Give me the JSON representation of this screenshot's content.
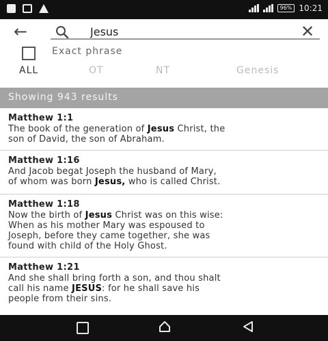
{
  "status_bar": {
    "time": "10:21",
    "battery_text": "96%"
  },
  "search": {
    "query": "Jesus"
  },
  "exact_phrase": {
    "label": "Exact phrase",
    "checked": false
  },
  "tabs": [
    {
      "label": "ALL",
      "active": true
    },
    {
      "label": "OT",
      "active": false
    },
    {
      "label": "NT",
      "active": false
    },
    {
      "label": "Genesis",
      "active": false
    }
  ],
  "results_header": "Showing 943 results",
  "results": [
    {
      "reference": "Matthew 1:1",
      "lines": [
        [
          {
            "t": "The book of the generation of "
          },
          {
            "t": "Jesus",
            "b": true
          },
          {
            "t": " Christ, the"
          }
        ],
        [
          {
            "t": "son of David, the son of Abraham."
          }
        ]
      ]
    },
    {
      "reference": "Matthew 1:16",
      "lines": [
        [
          {
            "t": "And Jacob begat Joseph the husband of Mary,"
          }
        ],
        [
          {
            "t": "of whom was born "
          },
          {
            "t": "Jesus,",
            "b": true
          },
          {
            "t": " who is called Christ."
          }
        ]
      ]
    },
    {
      "reference": "Matthew 1:18",
      "lines": [
        [
          {
            "t": "Now the birth of "
          },
          {
            "t": "Jesus",
            "b": true
          },
          {
            "t": " Christ was on this wise:"
          }
        ],
        [
          {
            "t": "When as his mother Mary was espoused to"
          }
        ],
        [
          {
            "t": "Joseph, before they came together, she was"
          }
        ],
        [
          {
            "t": "found with child of the Holy Ghost."
          }
        ]
      ]
    },
    {
      "reference": "Matthew 1:21",
      "lines": [
        [
          {
            "t": "And she shall bring forth a son, and thou shalt"
          }
        ],
        [
          {
            "t": "call his name "
          },
          {
            "t": "JESUS",
            "b": true
          },
          {
            "t": ": for he shall save his"
          }
        ],
        [
          {
            "t": "people from their sins."
          }
        ]
      ]
    }
  ]
}
